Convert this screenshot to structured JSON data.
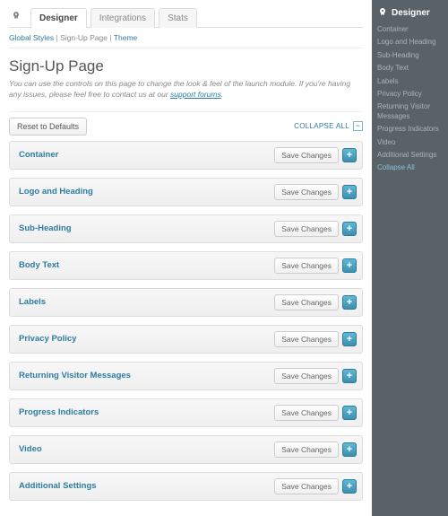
{
  "tabs": {
    "designer": "Designer",
    "integrations": "Integrations",
    "stats": "Stats"
  },
  "crumbs": {
    "global": "Global Styles",
    "signup": "Sign-Up Page",
    "theme": "Theme",
    "sep": "|"
  },
  "title": "Sign-Up Page",
  "intro_a": "You can use the controls on this page to change the look & feel of the launch module. If you're having any issues, please feel free to contact us at our ",
  "intro_link": "support forums",
  "intro_b": ".",
  "reset": "Reset to Defaults",
  "collapse_all": "COLLAPSE ALL",
  "save": "Save Changes",
  "panels": {
    "container": "Container",
    "logo": "Logo and Heading",
    "sub": "Sub-Heading",
    "body": "Body Text",
    "labels": "Labels",
    "privacy": "Privacy Policy",
    "returning": "Returning Visitor Messages",
    "progress": "Progress Indicators",
    "video": "Video",
    "additional": "Additional Settings"
  },
  "side": {
    "title": "Designer",
    "items": {
      "container": "Container",
      "logo": "Logo and Heading",
      "sub": "Sub-Heading",
      "body": "Body Text",
      "labels": "Labels",
      "privacy": "Privacy Policy",
      "returning": "Returning Visitor Messages",
      "progress": "Progress Indicators",
      "video": "Video",
      "additional": "Additional Settings",
      "collapse": "Collapse All"
    }
  }
}
